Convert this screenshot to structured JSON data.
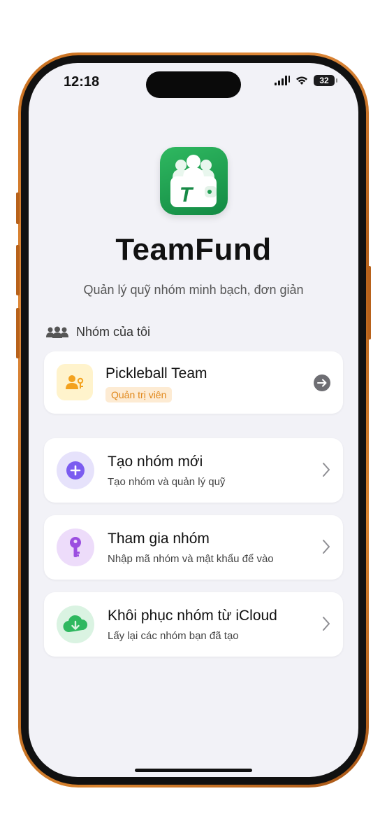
{
  "status_bar": {
    "time": "12:18",
    "battery": "32"
  },
  "app": {
    "name": "TeamFund",
    "tagline": "Quản lý quỹ nhóm minh bạch, đơn giản"
  },
  "my_groups": {
    "header": "Nhóm của tôi",
    "items": [
      {
        "name": "Pickleball Team",
        "role": "Quản trị viên"
      }
    ]
  },
  "actions": [
    {
      "title": "Tạo nhóm mới",
      "subtitle": "Tạo nhóm và quản lý quỹ",
      "icon": "plus-icon",
      "color": "#7b5cf0"
    },
    {
      "title": "Tham gia nhóm",
      "subtitle": "Nhập mã nhóm và mật khẩu để vào",
      "icon": "key-icon",
      "color": "#9b4fe0"
    },
    {
      "title": "Khôi phục nhóm từ iCloud",
      "subtitle": "Lấy lại các nhóm bạn đã tạo",
      "icon": "icloud-download-icon",
      "color": "#2fb860"
    }
  ]
}
